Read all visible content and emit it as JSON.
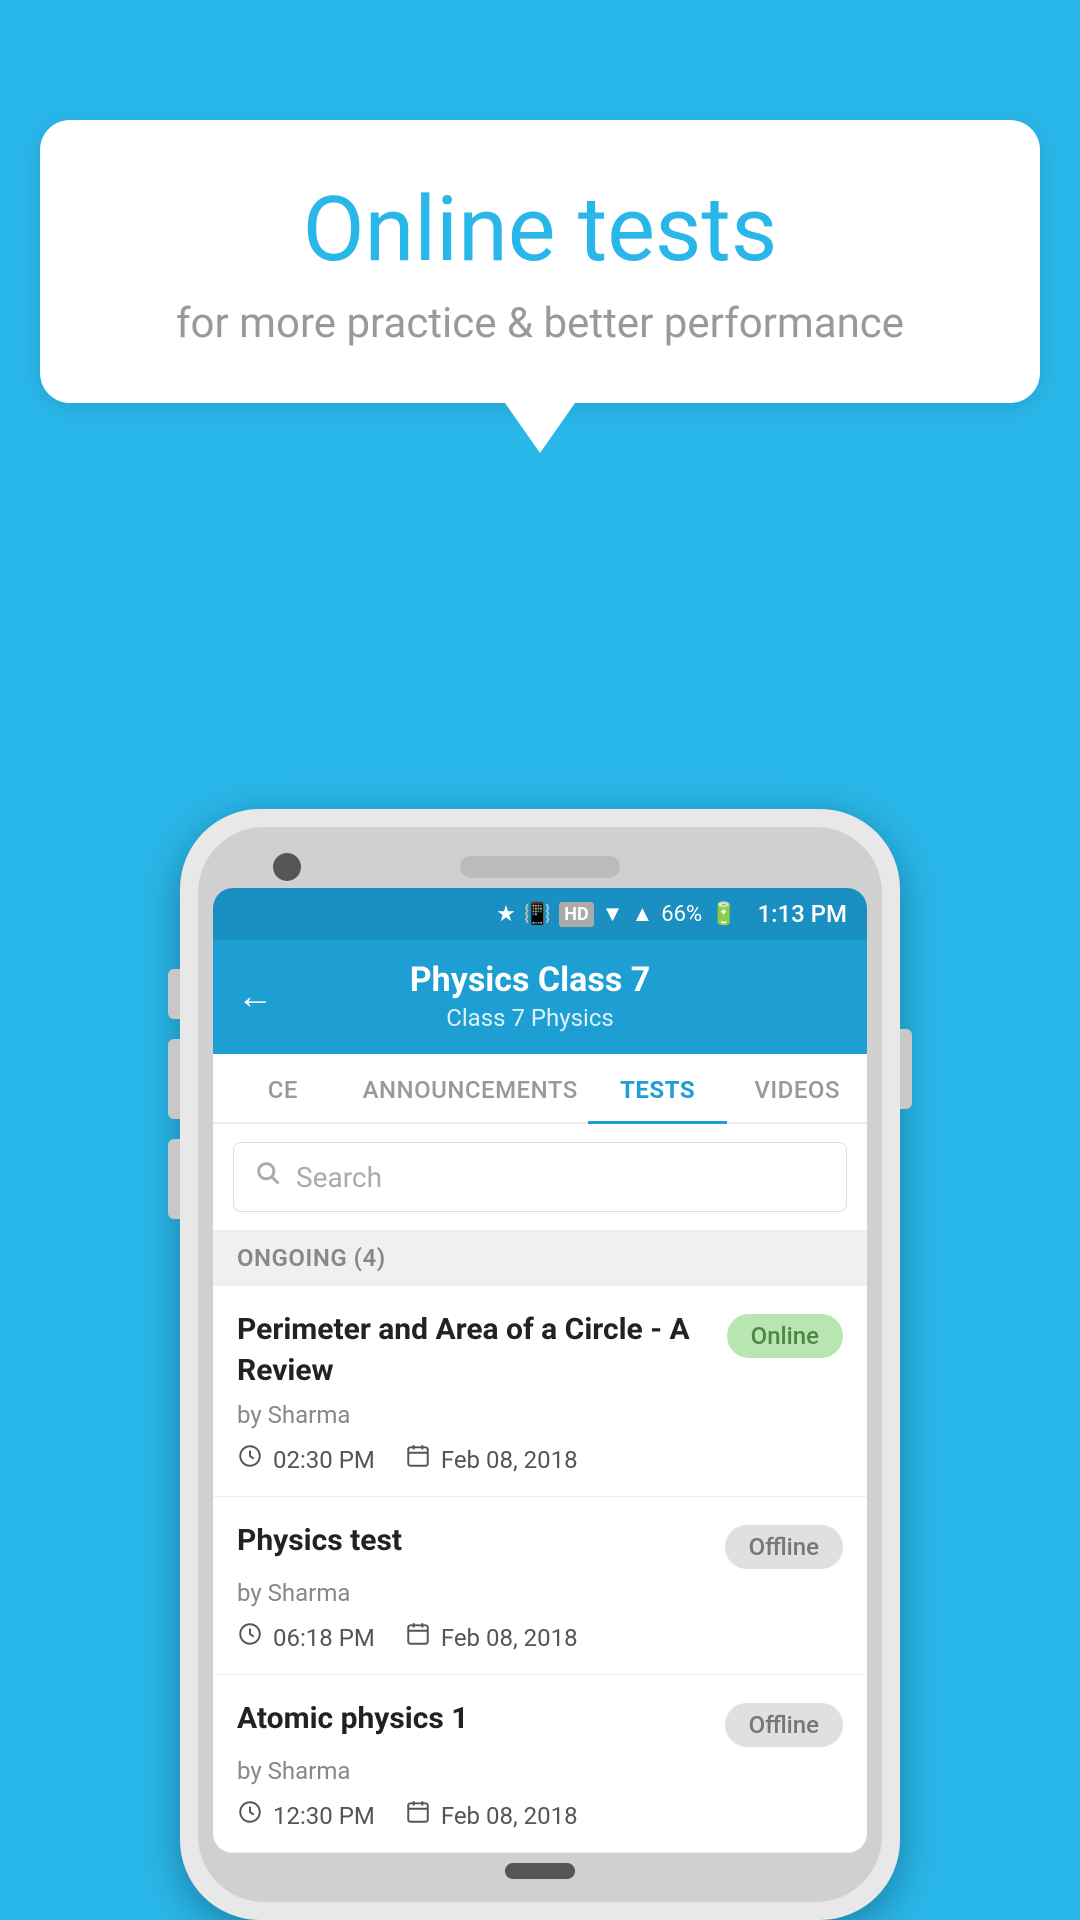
{
  "background_color": "#29b6e8",
  "speech_bubble": {
    "title": "Online tests",
    "subtitle": "for more practice & better performance"
  },
  "phone": {
    "status_bar": {
      "time": "1:13 PM",
      "battery": "66%"
    },
    "header": {
      "back_label": "←",
      "title": "Physics Class 7",
      "subtitle": "Class 7   Physics"
    },
    "tabs": [
      {
        "label": "CE",
        "active": false
      },
      {
        "label": "ANNOUNCEMENTS",
        "active": false
      },
      {
        "label": "TESTS",
        "active": true
      },
      {
        "label": "VIDEOS",
        "active": false
      }
    ],
    "search": {
      "placeholder": "Search"
    },
    "section": {
      "label": "ONGOING (4)"
    },
    "tests": [
      {
        "title": "Perimeter and Area of a Circle - A Review",
        "author": "by Sharma",
        "time": "02:30 PM",
        "date": "Feb 08, 2018",
        "status": "Online",
        "status_type": "online"
      },
      {
        "title": "Physics test",
        "author": "by Sharma",
        "time": "06:18 PM",
        "date": "Feb 08, 2018",
        "status": "Offline",
        "status_type": "offline"
      },
      {
        "title": "Atomic physics 1",
        "author": "by Sharma",
        "time": "12:30 PM",
        "date": "Feb 08, 2018",
        "status": "Offline",
        "status_type": "offline"
      }
    ]
  }
}
